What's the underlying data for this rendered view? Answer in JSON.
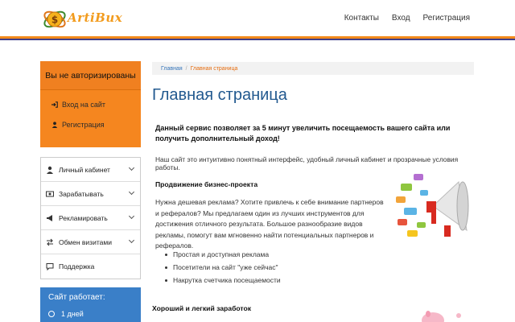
{
  "logo": {
    "text": "ArtiBux"
  },
  "nav": {
    "items": [
      "Контакты",
      "Вход",
      "Регистрация"
    ]
  },
  "sidebar": {
    "auth_title": "Вы не авторизированы",
    "login": "Вход на сайт",
    "register": "Регистрация",
    "menu": [
      {
        "label": "Личный кабинет",
        "icon": "user-icon"
      },
      {
        "label": "Зарабатывать",
        "icon": "money-icon"
      },
      {
        "label": "Рекламировать",
        "icon": "megaphone-icon"
      },
      {
        "label": "Обмен визитами",
        "icon": "exchange-icon"
      },
      {
        "label": "Поддержка",
        "icon": "support-icon"
      }
    ],
    "stats_title": "Сайт работает:",
    "uptime": "1 дней"
  },
  "breadcrumb": {
    "home": "Главная",
    "separator": "/",
    "current": "Главная страница"
  },
  "main": {
    "title": "Главная страница",
    "lead": "Данный сервис позволяет за 5 минут увеличить посещаемость вашего сайта или получить дополнительный доход!",
    "intro": "Наш сайт это интуитивно понятный интерфейс, удобный личный кабинет и прозрачные условия работы.",
    "promo_heading": "Продвижение бизнес-проекта",
    "promo_text": "Нужна дешевая реклама? Хотите привлечь к себе внимание партнеров и рефералов? Мы предлагаем один из лучших инструментов для достижения отличного результата. Большое разнообразие видов рекламы, помогут вам мгновенно найти потенциальных партнеров и рефералов.",
    "bullets": [
      "Простая и доступная реклама",
      "Посетители на сайт \"уже сейчас\"",
      "Накрутка счетчика посещаемости"
    ],
    "earn_heading": "Хороший и легкий заработок"
  },
  "colors": {
    "orange": "#f5861f",
    "blue_title": "#22598f",
    "stats_blue": "#3a7fc8",
    "breadcrumb_current": "#e66d10"
  }
}
